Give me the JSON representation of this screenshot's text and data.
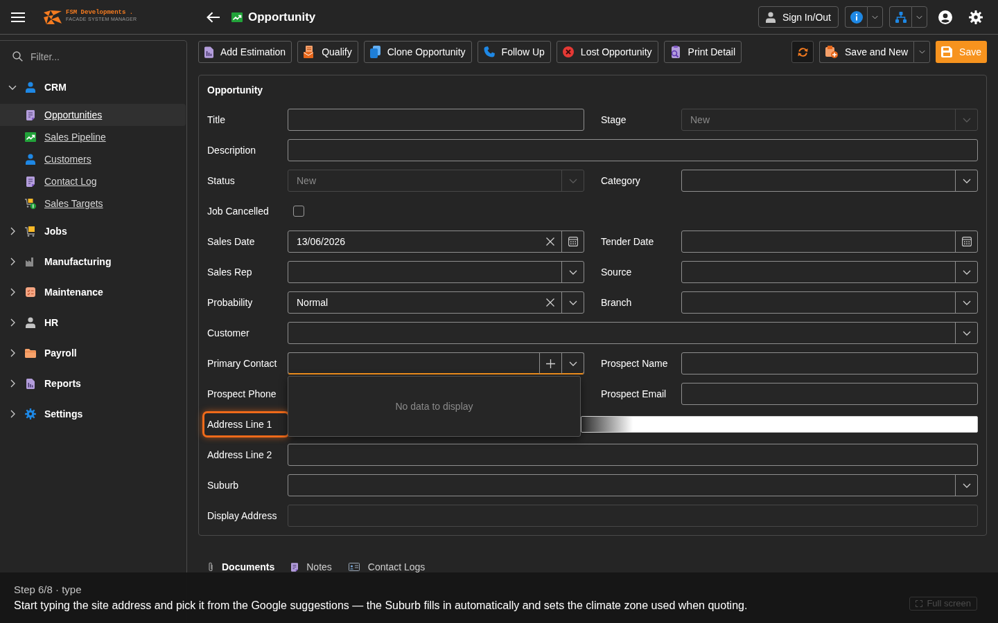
{
  "app_bar": {
    "brand": "FSM Developments .",
    "tagline": "FACADE SYSTEM MANAGER",
    "page_title": "Opportunity",
    "sign_in_out": "Sign In/Out"
  },
  "sidebar": {
    "filter": {
      "placeholder": "Filter..."
    },
    "groups": [
      {
        "label": "CRM",
        "expanded": true,
        "children": [
          {
            "label": "Opportunities",
            "selected": true
          },
          {
            "label": "Sales Pipeline",
            "selected": false
          },
          {
            "label": "Customers",
            "selected": false
          },
          {
            "label": "Contact Log",
            "selected": false
          },
          {
            "label": "Sales Targets",
            "selected": false
          }
        ]
      },
      {
        "label": "Jobs",
        "expanded": false
      },
      {
        "label": "Manufacturing",
        "expanded": false
      },
      {
        "label": "Maintenance",
        "expanded": false
      },
      {
        "label": "HR",
        "expanded": false
      },
      {
        "label": "Payroll",
        "expanded": false
      },
      {
        "label": "Reports",
        "expanded": false
      },
      {
        "label": "Settings",
        "expanded": false
      }
    ]
  },
  "toolbar": {
    "actions": [
      {
        "label": "Add Estimation"
      },
      {
        "label": "Qualify"
      },
      {
        "label": "Clone Opportunity"
      },
      {
        "label": "Follow Up"
      },
      {
        "label": "Lost Opportunity"
      },
      {
        "label": "Print Detail"
      }
    ],
    "save_and_new": "Save and New",
    "save": "Save"
  },
  "form": {
    "title": "Opportunity",
    "rows": [
      {
        "fields": [
          {
            "label": "Title",
            "kind": "text",
            "disabled": false,
            "highlighted": false
          },
          {
            "label": "Stage",
            "kind": "select",
            "value": "New",
            "disabled": true,
            "expanded": false,
            "highlighted": false
          }
        ]
      },
      {
        "fields": [
          {
            "label": "Description",
            "kind": "text",
            "disabled": false,
            "highlighted": false
          }
        ]
      },
      {
        "fields": [
          {
            "label": "Status",
            "kind": "select",
            "value": "New",
            "disabled": true,
            "expanded": false,
            "highlighted": false
          },
          {
            "label": "Category",
            "kind": "select",
            "disabled": false,
            "expanded": false,
            "highlighted": false
          }
        ]
      },
      {
        "fields": [
          {
            "label": "Job Cancelled",
            "kind": "checkbox",
            "checked": false,
            "disabled": false,
            "highlighted": false
          }
        ]
      },
      {
        "fields": [
          {
            "label": "Sales Date",
            "kind": "date",
            "value": "13/06/2026",
            "disabled": false,
            "expanded": false,
            "highlighted": false
          },
          {
            "label": "Tender Date",
            "kind": "date",
            "disabled": false,
            "expanded": false,
            "highlighted": false
          }
        ]
      },
      {
        "fields": [
          {
            "label": "Sales Rep",
            "kind": "select",
            "disabled": false,
            "expanded": false,
            "highlighted": false
          },
          {
            "label": "Source",
            "kind": "select",
            "disabled": false,
            "expanded": false,
            "highlighted": false
          }
        ]
      },
      {
        "fields": [
          {
            "label": "Probability",
            "kind": "select",
            "value": "Normal",
            "disabled": false,
            "expanded": false,
            "highlighted": false
          },
          {
            "label": "Branch",
            "kind": "select",
            "disabled": false,
            "expanded": false,
            "highlighted": false
          }
        ]
      },
      {
        "fields": [
          {
            "label": "Customer",
            "kind": "select",
            "disabled": false,
            "expanded": false,
            "highlighted": false
          }
        ]
      },
      {
        "fields": [
          {
            "label": "Primary Contact",
            "kind": "combo",
            "disabled": false,
            "expanded": true,
            "highlighted": false,
            "dropdown": {
              "message": "No data to display"
            }
          },
          {
            "label": "Prospect Name",
            "kind": "text",
            "disabled": false,
            "highlighted": false
          }
        ]
      },
      {
        "fields": [
          {
            "label": "Prospect Phone",
            "highlighted": false
          },
          {
            "label": "Prospect Email",
            "kind": "text",
            "disabled": false,
            "highlighted": false
          }
        ]
      },
      {
        "fields": [
          {
            "label": "Address Line 1",
            "kind": "address",
            "disabled": false,
            "highlighted": true
          }
        ]
      },
      {
        "fields": [
          {
            "label": "Address Line 2",
            "kind": "text",
            "disabled": false,
            "highlighted": false
          }
        ]
      },
      {
        "fields": [
          {
            "label": "Suburb",
            "kind": "select",
            "disabled": false,
            "expanded": false,
            "highlighted": false
          }
        ]
      },
      {
        "fields": [
          {
            "label": "Display Address",
            "kind": "text",
            "disabled": true,
            "highlighted": false
          }
        ]
      }
    ]
  },
  "tabs": [
    {
      "label": "Documents",
      "selected": true
    },
    {
      "label": "Notes",
      "selected": false
    },
    {
      "label": "Contact Logs",
      "selected": false
    }
  ],
  "tour": {
    "step": "Step 6/8 · type",
    "text": "Start typing the site address and pick it from the Google suggestions — the Suburb fills in automatically and sets the climate zone used when quoting."
  },
  "footer": {
    "full_screen": "Full screen"
  }
}
